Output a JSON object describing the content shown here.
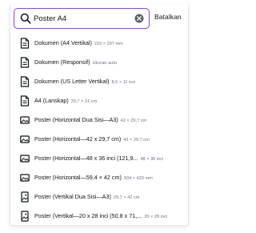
{
  "search": {
    "value": "Poster A4",
    "cancel_label": "Batalkan"
  },
  "colors": {
    "accent": "#8b3dff",
    "text": "#0e1318",
    "dim": "#6b7280"
  },
  "items": [
    {
      "icon": "document-icon",
      "label": "Dokumen (A4 Vertikal)",
      "dim": "210 × 297 mm"
    },
    {
      "icon": "document-icon",
      "label": "Dokumen (Responsif)",
      "dim": "Ukuran auto"
    },
    {
      "icon": "document-icon",
      "label": "Dokumen (US Letter Vertikal)",
      "dim": "8,5 × 11 inci"
    },
    {
      "icon": "document-icon",
      "label": "A4 (Lanskap)",
      "dim": "29,7 × 21 cm"
    },
    {
      "icon": "poster-landscape-icon",
      "label": "Poster (Horizontal Dua Sisi—A3)",
      "dim": "42 × 29,7 cm"
    },
    {
      "icon": "poster-landscape-icon",
      "label": "Poster (Horizontal—42 x 29,7 cm)",
      "dim": "42 × 29,7 cm"
    },
    {
      "icon": "poster-landscape-icon",
      "label": "Poster (Horizontal—48 x 36 inci (121,9...",
      "dim": "48 × 36 inci"
    },
    {
      "icon": "poster-landscape-icon",
      "label": "Poster (Horizontal—59,4 × 42 cm)",
      "dim": "594 × 420 mm"
    },
    {
      "icon": "poster-portrait-icon",
      "label": "Poster (Vertikal Dua Sisi—A3)",
      "dim": "29,7 × 42 cm"
    },
    {
      "icon": "poster-portrait-icon",
      "label": "Poster (Vertikal—20 x 28 inci (50,8 x 71,...",
      "dim": "20 × 28 inci"
    }
  ]
}
